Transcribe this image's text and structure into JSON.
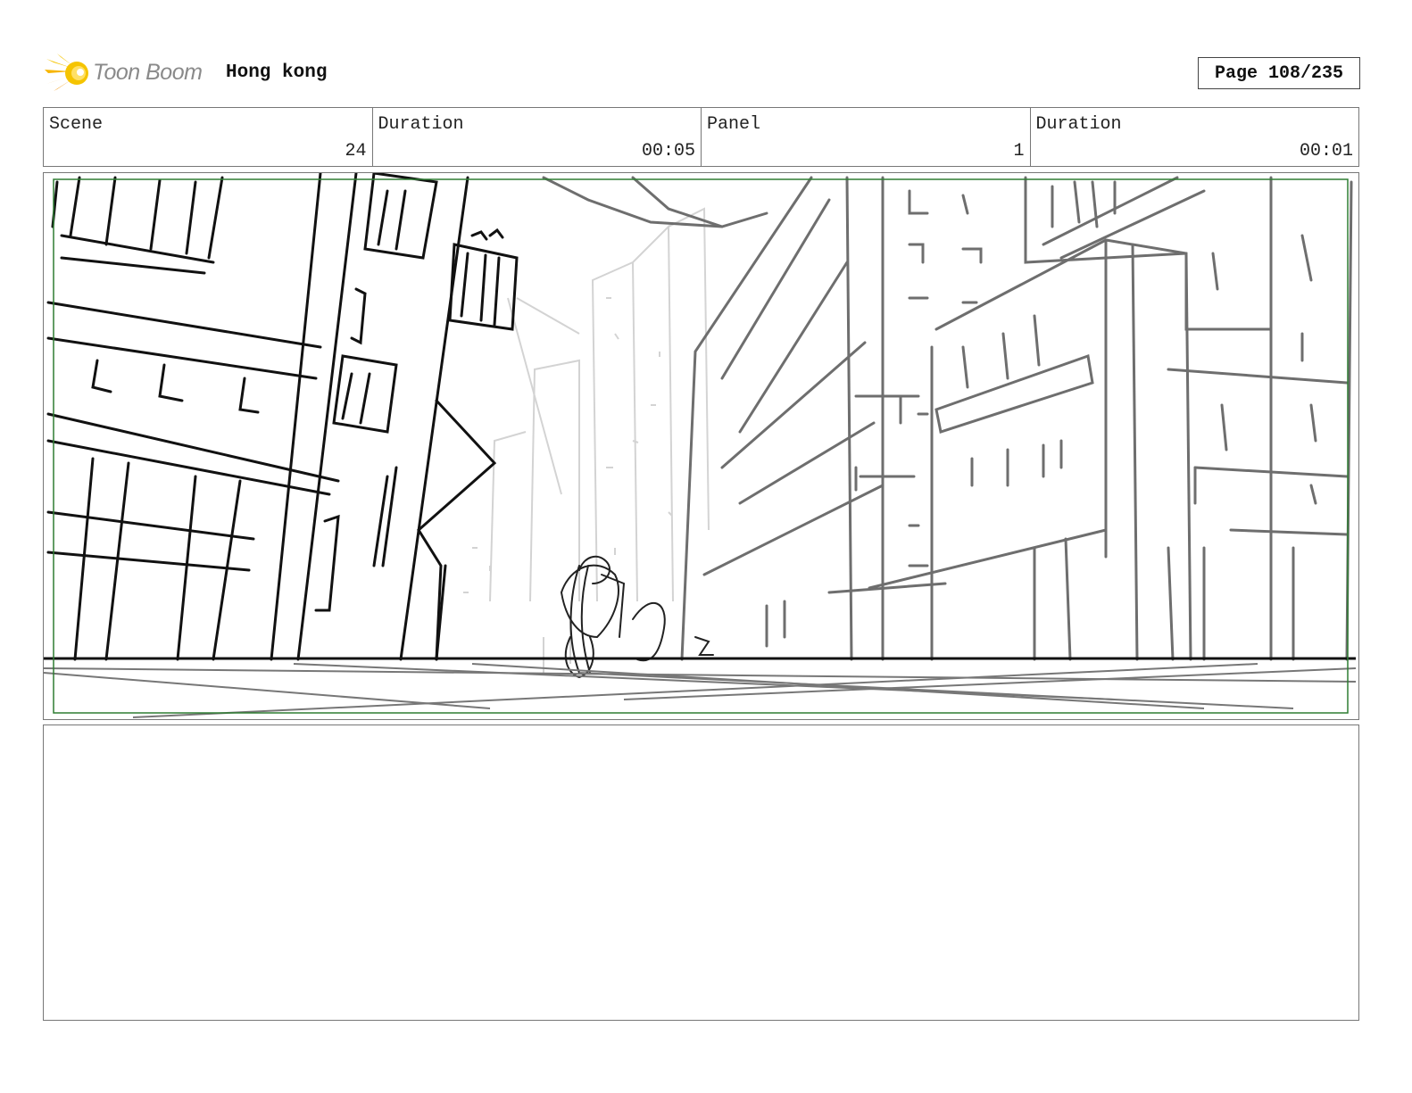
{
  "header": {
    "logo_text": "Toon Boom",
    "logo_icon": "comet-logo-icon",
    "project_title": "Hong kong",
    "page_label": "Page 108/235"
  },
  "info_row": {
    "scene": {
      "label": "Scene",
      "value": "24"
    },
    "scene_duration": {
      "label": "Duration",
      "value": "00:05"
    },
    "panel": {
      "label": "Panel",
      "value": "1"
    },
    "panel_duration": {
      "label": "Duration",
      "value": "00:01"
    }
  },
  "colors": {
    "logo_yellow": "#f5c400",
    "logo_orange": "#f39200",
    "safe_frame_green": "#2e7d32",
    "border_gray": "#777777"
  }
}
